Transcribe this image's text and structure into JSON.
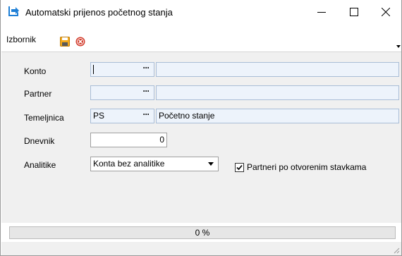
{
  "window": {
    "title": "Automatski prijenos početnog stanja"
  },
  "menu": {
    "izbornik": "Izbornik"
  },
  "form": {
    "konto": {
      "label": "Konto",
      "code": "",
      "description": ""
    },
    "partner": {
      "label": "Partner",
      "code": "",
      "description": ""
    },
    "temeljnica": {
      "label": "Temeljnica",
      "code": "PS",
      "description": "Početno stanje"
    },
    "dnevnik": {
      "label": "Dnevnik",
      "value": "0"
    },
    "analitike": {
      "label": "Analitike",
      "selected": "Konta bez analitike"
    },
    "partneri_checkbox": {
      "label": "Partneri po otvorenim stavkama",
      "checked": true
    },
    "lookup_button": "···"
  },
  "progress": {
    "text": "0 %",
    "value": 0
  },
  "colors": {
    "accent": "#1e7fd6",
    "save": "#f2a91b",
    "cancel": "#d23a2a"
  }
}
